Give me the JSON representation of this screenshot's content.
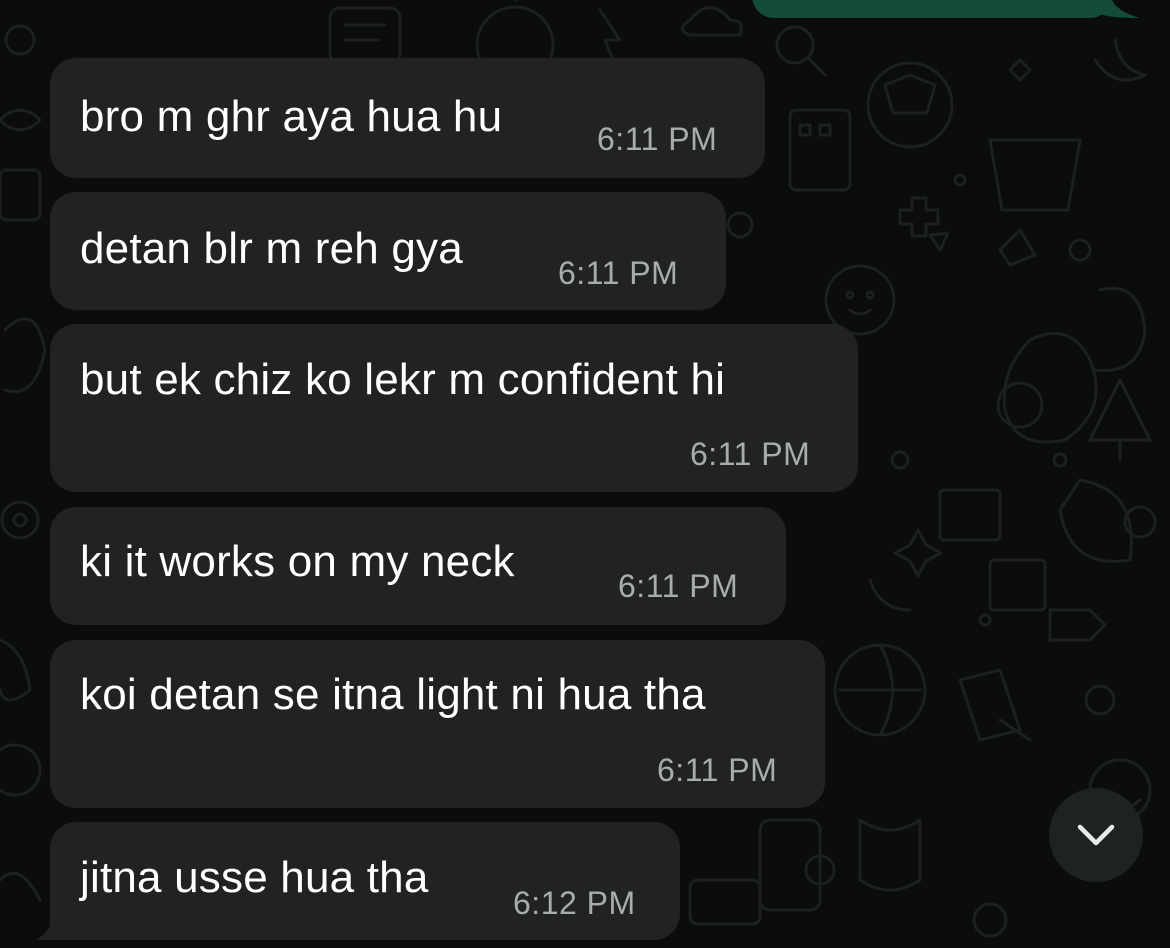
{
  "colors": {
    "background": "#0b0c0c",
    "incoming_bubble": "#202223",
    "outgoing_bubble": "#134d37",
    "message_text": "#ffffff",
    "timestamp_text": "#a9acad"
  },
  "messages": [
    {
      "text": "bro m ghr aya hua hu",
      "time": "6:11 PM"
    },
    {
      "text": "detan blr m reh gya",
      "time": "6:11 PM"
    },
    {
      "text": "but ek chiz ko lekr m confident hi",
      "time": "6:11 PM"
    },
    {
      "text": "ki it works on my neck",
      "time": "6:11 PM"
    },
    {
      "text": "koi detan se itna light ni hua tha",
      "time": "6:11 PM"
    },
    {
      "text": "jitna usse hua tha",
      "time": "6:12 PM"
    }
  ],
  "scroll_button": {
    "icon": "chevron-down-icon"
  }
}
